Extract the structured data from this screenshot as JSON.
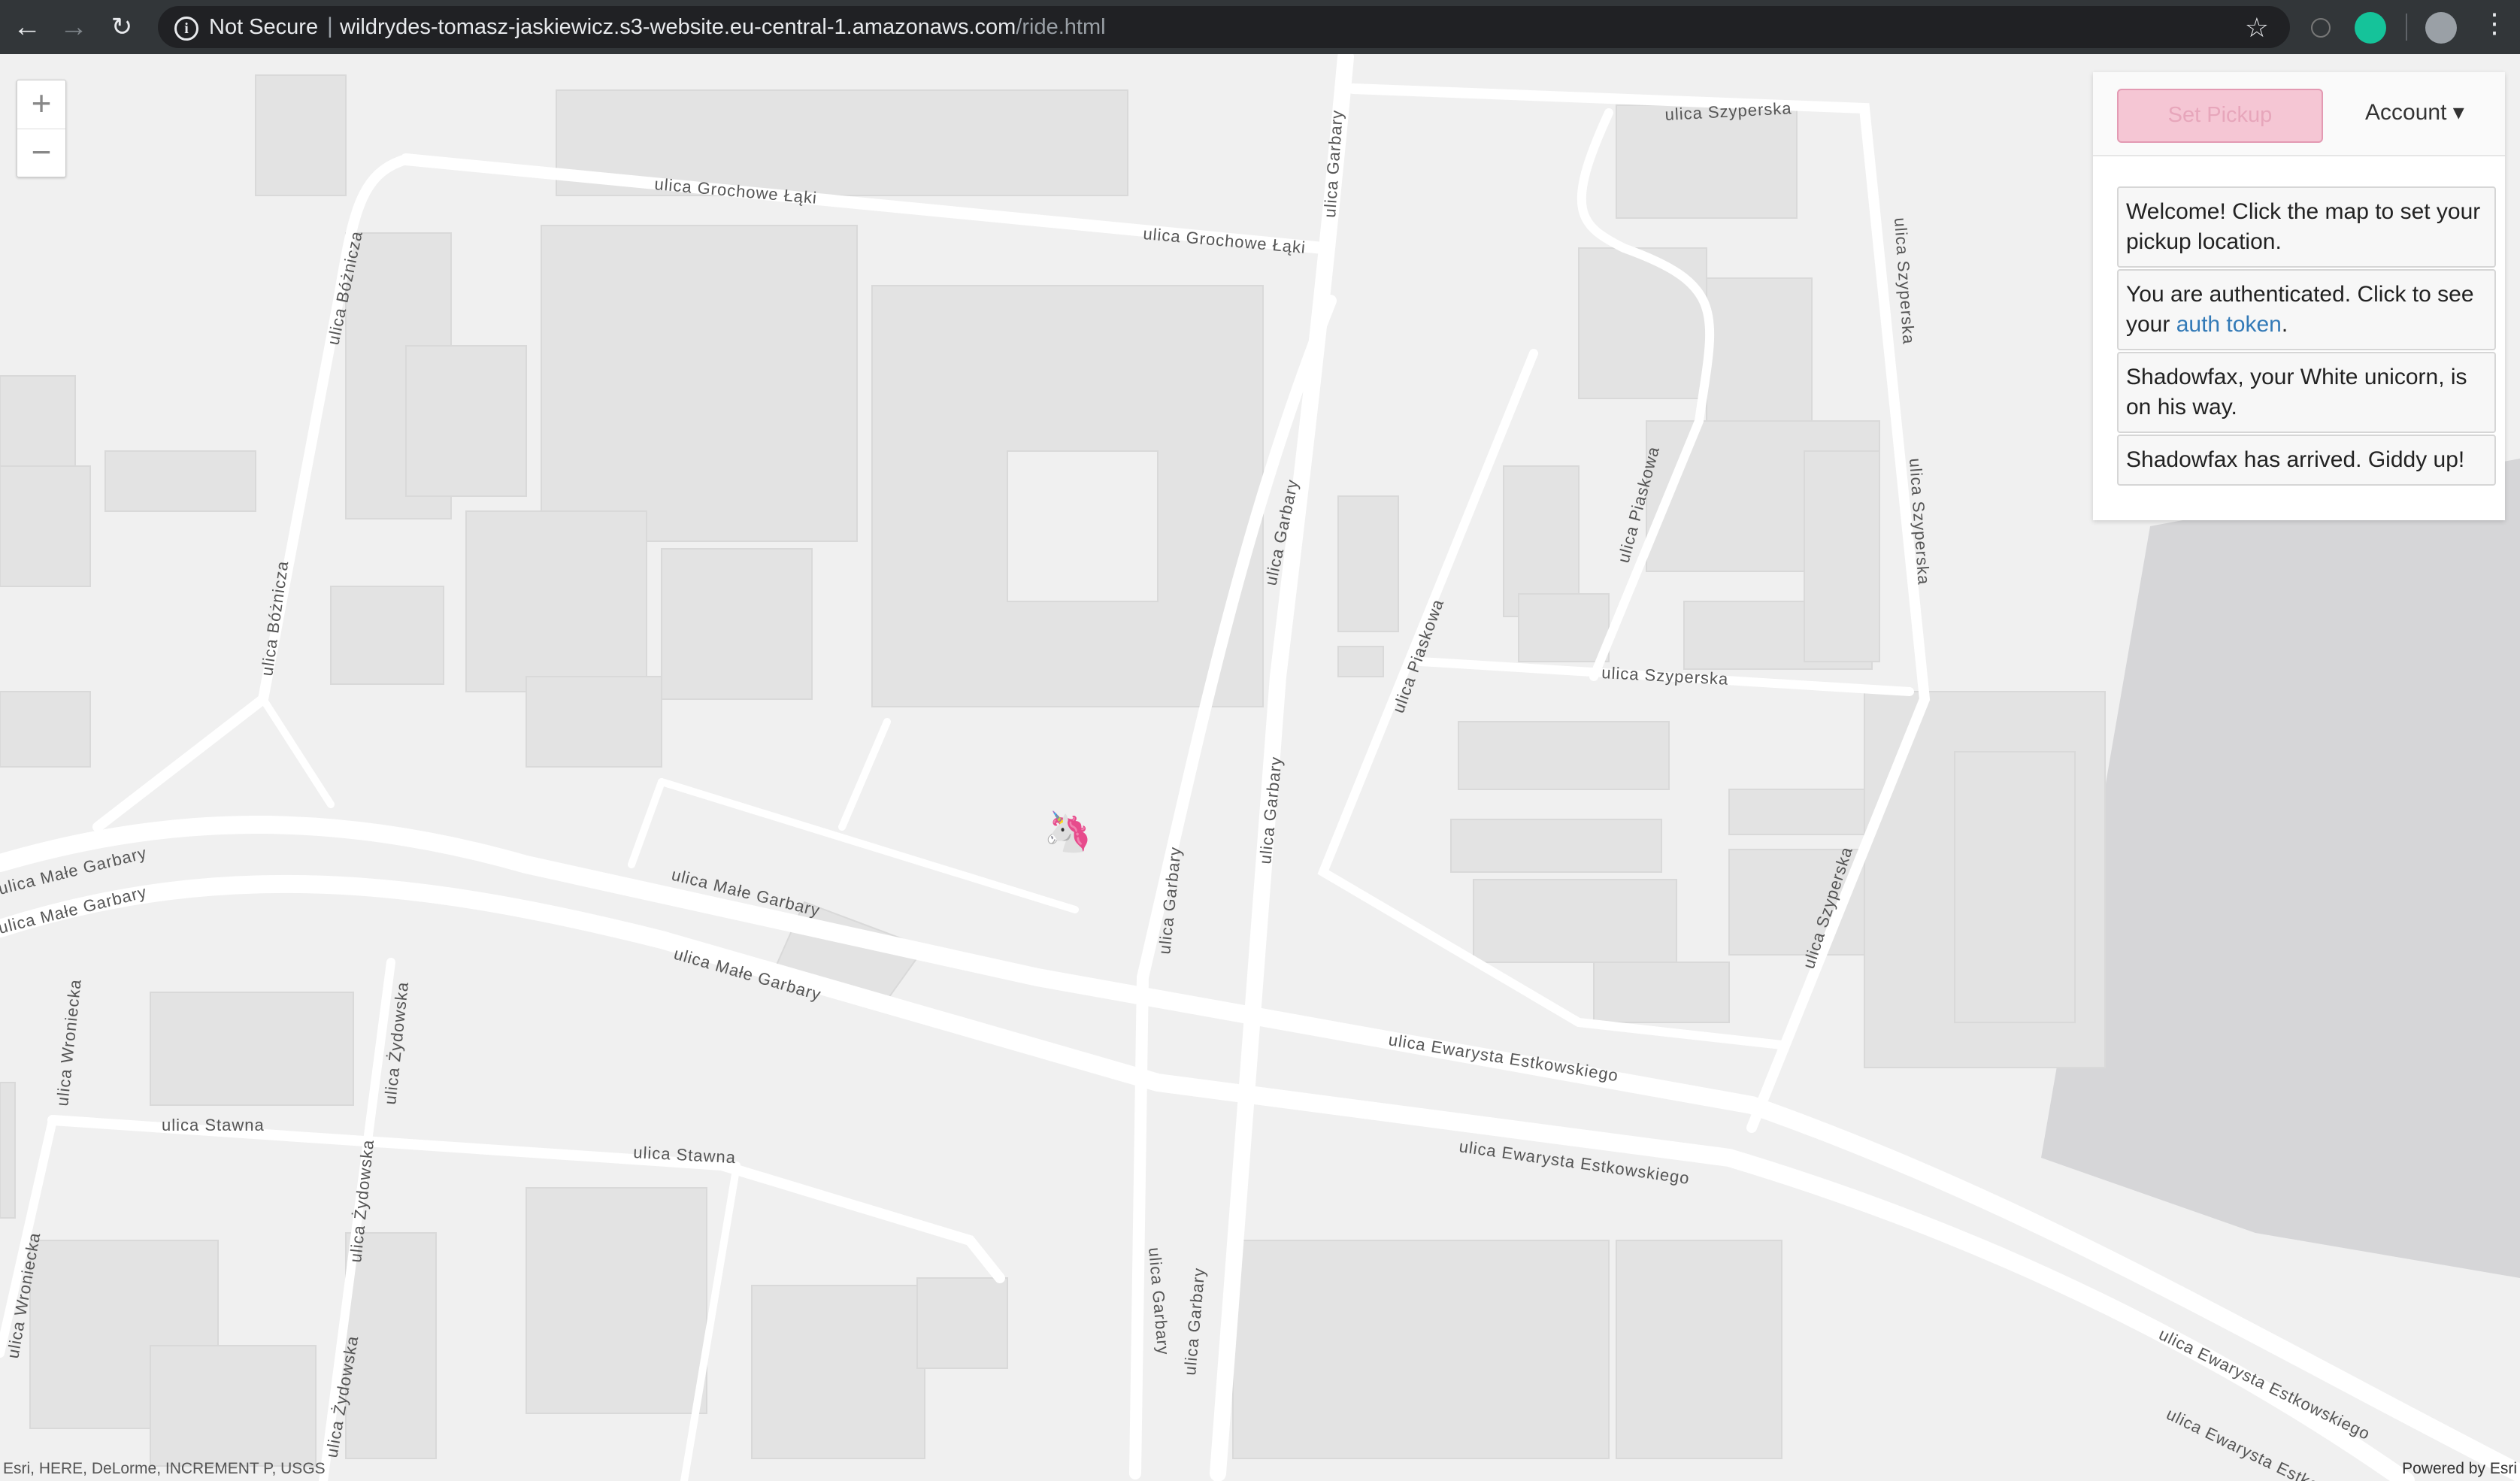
{
  "browser": {
    "not_secure": "Not Secure",
    "url_host": "wildrydes-tomasz-jaskiewicz.s3-website.eu-central-1.amazonaws.com",
    "url_path": "/ride.html"
  },
  "toolbar": {
    "set_pickup_label": "Set Pickup",
    "account_label": "Account ▾"
  },
  "messages": {
    "welcome": "Welcome! Click the map to set your pickup location.",
    "auth_prefix": "You are authenticated. Click to see your ",
    "auth_link": "auth token",
    "auth_suffix": ".",
    "on_way": "Shadowfax, your White unicorn, is on his way.",
    "arrived": "Shadowfax has arrived. Giddy up!"
  },
  "map": {
    "zoom_in": "+",
    "zoom_out": "−",
    "attribution": "Esri, HERE, DeLorme, INCREMENT P, USGS",
    "powered_by": "Powered by Esri",
    "road_labels": {
      "grochowe1": "ulica Grochowe Łąki",
      "grochowe2": "ulica Grochowe Łąki",
      "szyperska_top": "ulica Szyperska",
      "szyperska_mid": "ulica Szyperska",
      "szyperska_r1": "ulica Szyperska",
      "szyperska_r2": "ulica Szyperska",
      "szyperska_r3": "ulica Szyperska",
      "garbary1": "ulica Garbary",
      "garbary2": "ulica Garbary",
      "garbary3": "ulica Garbary",
      "garbary4": "ulica Garbary",
      "garbary5": "ulica Garbary",
      "garbary6": "ulica Garbary",
      "boznicza1": "ulica Bóżnicza",
      "boznicza2": "ulica Bóżnicza",
      "piaskowa1": "ulica Piaskowa",
      "piaskowa2": "ulica Piaskowa",
      "male1": "ulica Małe Garbary",
      "male2": "ulica Małe Garbary",
      "male3": "ulica Małe Garbary",
      "male4": "ulica Małe Garbary",
      "estk1": "ulica Ewarysta Estkowskiego",
      "estk2": "ulica Ewarysta Estkowskiego",
      "estk3": "ulica Ewarysta Estkowskiego",
      "estk4": "ulica Ewarysta Estkowskiego",
      "stawna1": "ulica Stawna",
      "stawna2": "ulica Stawna",
      "wroniecka1": "ulica Wroniecka",
      "wroniecka2": "ulica Wroniecka",
      "zydowska1": "ulica Żydowska",
      "zydowska2": "ulica Żydowska",
      "zydowska3": "ulica Żydowska"
    },
    "unicorn": "🦄"
  }
}
